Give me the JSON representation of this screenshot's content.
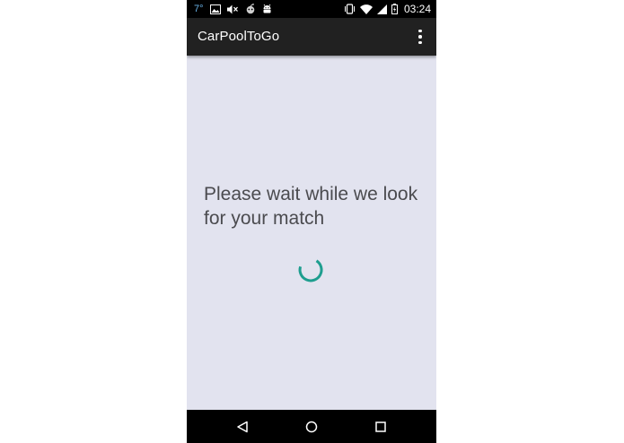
{
  "status_bar": {
    "temperature": "7°",
    "time": "03:24",
    "icons_left": [
      "image-icon",
      "mute-icon",
      "alien-icon",
      "android-icon"
    ],
    "icons_right": [
      "vibrate-icon",
      "wifi-icon",
      "signal-icon",
      "battery-icon"
    ]
  },
  "app_bar": {
    "title": "CarPoolToGo",
    "menu_icon": "overflow-menu-icon"
  },
  "main": {
    "message": "Please wait while we look for your match",
    "spinner_color": "#1e9e8f"
  },
  "nav_bar": {
    "buttons": [
      "back-icon",
      "home-icon",
      "recents-icon"
    ]
  },
  "colors": {
    "background": "#e2e3ef",
    "app_bar": "#212121",
    "status_bar": "#000000",
    "text": "#4b4b4f",
    "accent": "#1e9e8f"
  }
}
